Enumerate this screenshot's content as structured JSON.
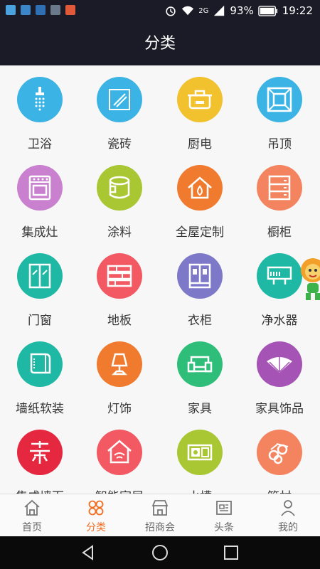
{
  "status_bar": {
    "network": "2G",
    "battery": "93%",
    "time": "19:22",
    "icons": [
      "gallery-icon",
      "message-icon",
      "health-icon",
      "photo-icon",
      "block-icon",
      "alarm-icon",
      "wifi-icon",
      "signal-icon",
      "battery-icon"
    ]
  },
  "header": {
    "title": "分类"
  },
  "categories": [
    {
      "label": "卫浴",
      "color": "#3bb4e5",
      "icon": "shower-icon"
    },
    {
      "label": "瓷砖",
      "color": "#3bb4e5",
      "icon": "tile-icon"
    },
    {
      "label": "厨电",
      "color": "#f2c12e",
      "icon": "cooker-icon"
    },
    {
      "label": "吊顶",
      "color": "#3bb4e5",
      "icon": "ceiling-icon"
    },
    {
      "label": "集成灶",
      "color": "#c980cf",
      "icon": "stove-icon"
    },
    {
      "label": "涂料",
      "color": "#a9c733",
      "icon": "paint-bucket-icon"
    },
    {
      "label": "全屋定制",
      "color": "#f07a2d",
      "icon": "house-icon"
    },
    {
      "label": "橱柜",
      "color": "#f4845f",
      "icon": "cabinet-icon"
    },
    {
      "label": "门窗",
      "color": "#1fb8a4",
      "icon": "window-icon"
    },
    {
      "label": "地板",
      "color": "#f25963",
      "icon": "floor-icon"
    },
    {
      "label": "衣柜",
      "color": "#7d79c8",
      "icon": "wardrobe-icon"
    },
    {
      "label": "净水器",
      "color": "#1fb8a4",
      "icon": "water-purifier-icon"
    },
    {
      "label": "墙纸软装",
      "color": "#1fb8a4",
      "icon": "wallpaper-icon"
    },
    {
      "label": "灯饰",
      "color": "#f07a2d",
      "icon": "lamp-icon"
    },
    {
      "label": "家具",
      "color": "#2fbe7a",
      "icon": "sofa-icon"
    },
    {
      "label": "家具饰品",
      "color": "#a553b5",
      "icon": "fan-icon"
    },
    {
      "label": "集成墙面",
      "color": "#e5283f",
      "icon": "wall-panel-icon"
    },
    {
      "label": "智能家居",
      "color": "#f25963",
      "icon": "smart-home-icon"
    },
    {
      "label": "水槽",
      "color": "#a9c733",
      "icon": "sink-icon"
    },
    {
      "label": "管材",
      "color": "#f4845f",
      "icon": "pipe-icon"
    }
  ],
  "bottom_nav": [
    {
      "label": "首页",
      "icon": "home-icon",
      "active": false
    },
    {
      "label": "分类",
      "icon": "category-icon",
      "active": true
    },
    {
      "label": "招商会",
      "icon": "store-icon",
      "active": false
    },
    {
      "label": "头条",
      "icon": "news-icon",
      "active": false
    },
    {
      "label": "我的",
      "icon": "user-icon",
      "active": false
    }
  ],
  "colors": {
    "accent": "#f36d21",
    "header_bg": "#1b1b27",
    "content_bg": "#f7f7f7"
  }
}
